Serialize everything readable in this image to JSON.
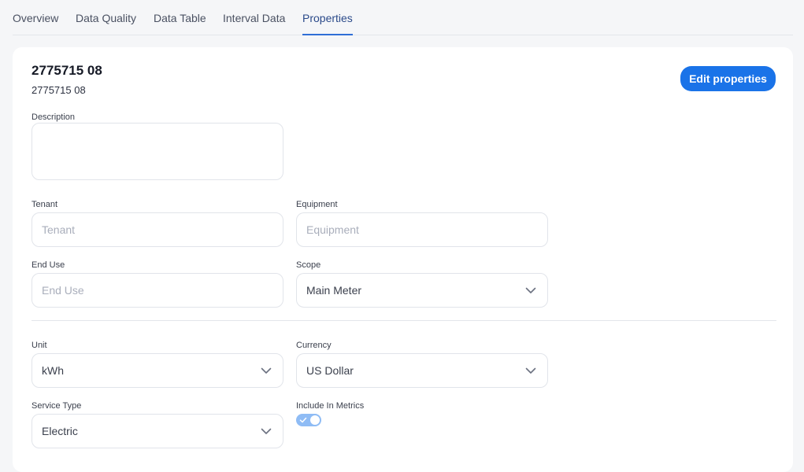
{
  "tabs": [
    {
      "label": "Overview"
    },
    {
      "label": "Data Quality"
    },
    {
      "label": "Data Table"
    },
    {
      "label": "Interval Data"
    },
    {
      "label": "Properties"
    }
  ],
  "active_tab": "Properties",
  "header": {
    "title": "2775715 08",
    "subtitle": "2775715 08",
    "edit_label": "Edit properties"
  },
  "fields": {
    "description": {
      "label": "Description",
      "value": ""
    },
    "tenant": {
      "label": "Tenant",
      "placeholder": "Tenant"
    },
    "equipment": {
      "label": "Equipment",
      "placeholder": "Equipment"
    },
    "end_use": {
      "label": "End Use",
      "placeholder": "End Use"
    },
    "scope": {
      "label": "Scope",
      "value": "Main Meter"
    },
    "unit": {
      "label": "Unit",
      "value": "kWh"
    },
    "currency": {
      "label": "Currency",
      "value": "US Dollar"
    },
    "service_type": {
      "label": "Service Type",
      "value": "Electric"
    },
    "include_in_metrics": {
      "label": "Include In Metrics",
      "enabled": true
    }
  },
  "colors": {
    "accent": "#1a73e8",
    "toggle_on": "#8fbcf5"
  },
  "icons": {
    "dropdown": "chevron-down-icon",
    "toggle_check": "check-icon"
  }
}
